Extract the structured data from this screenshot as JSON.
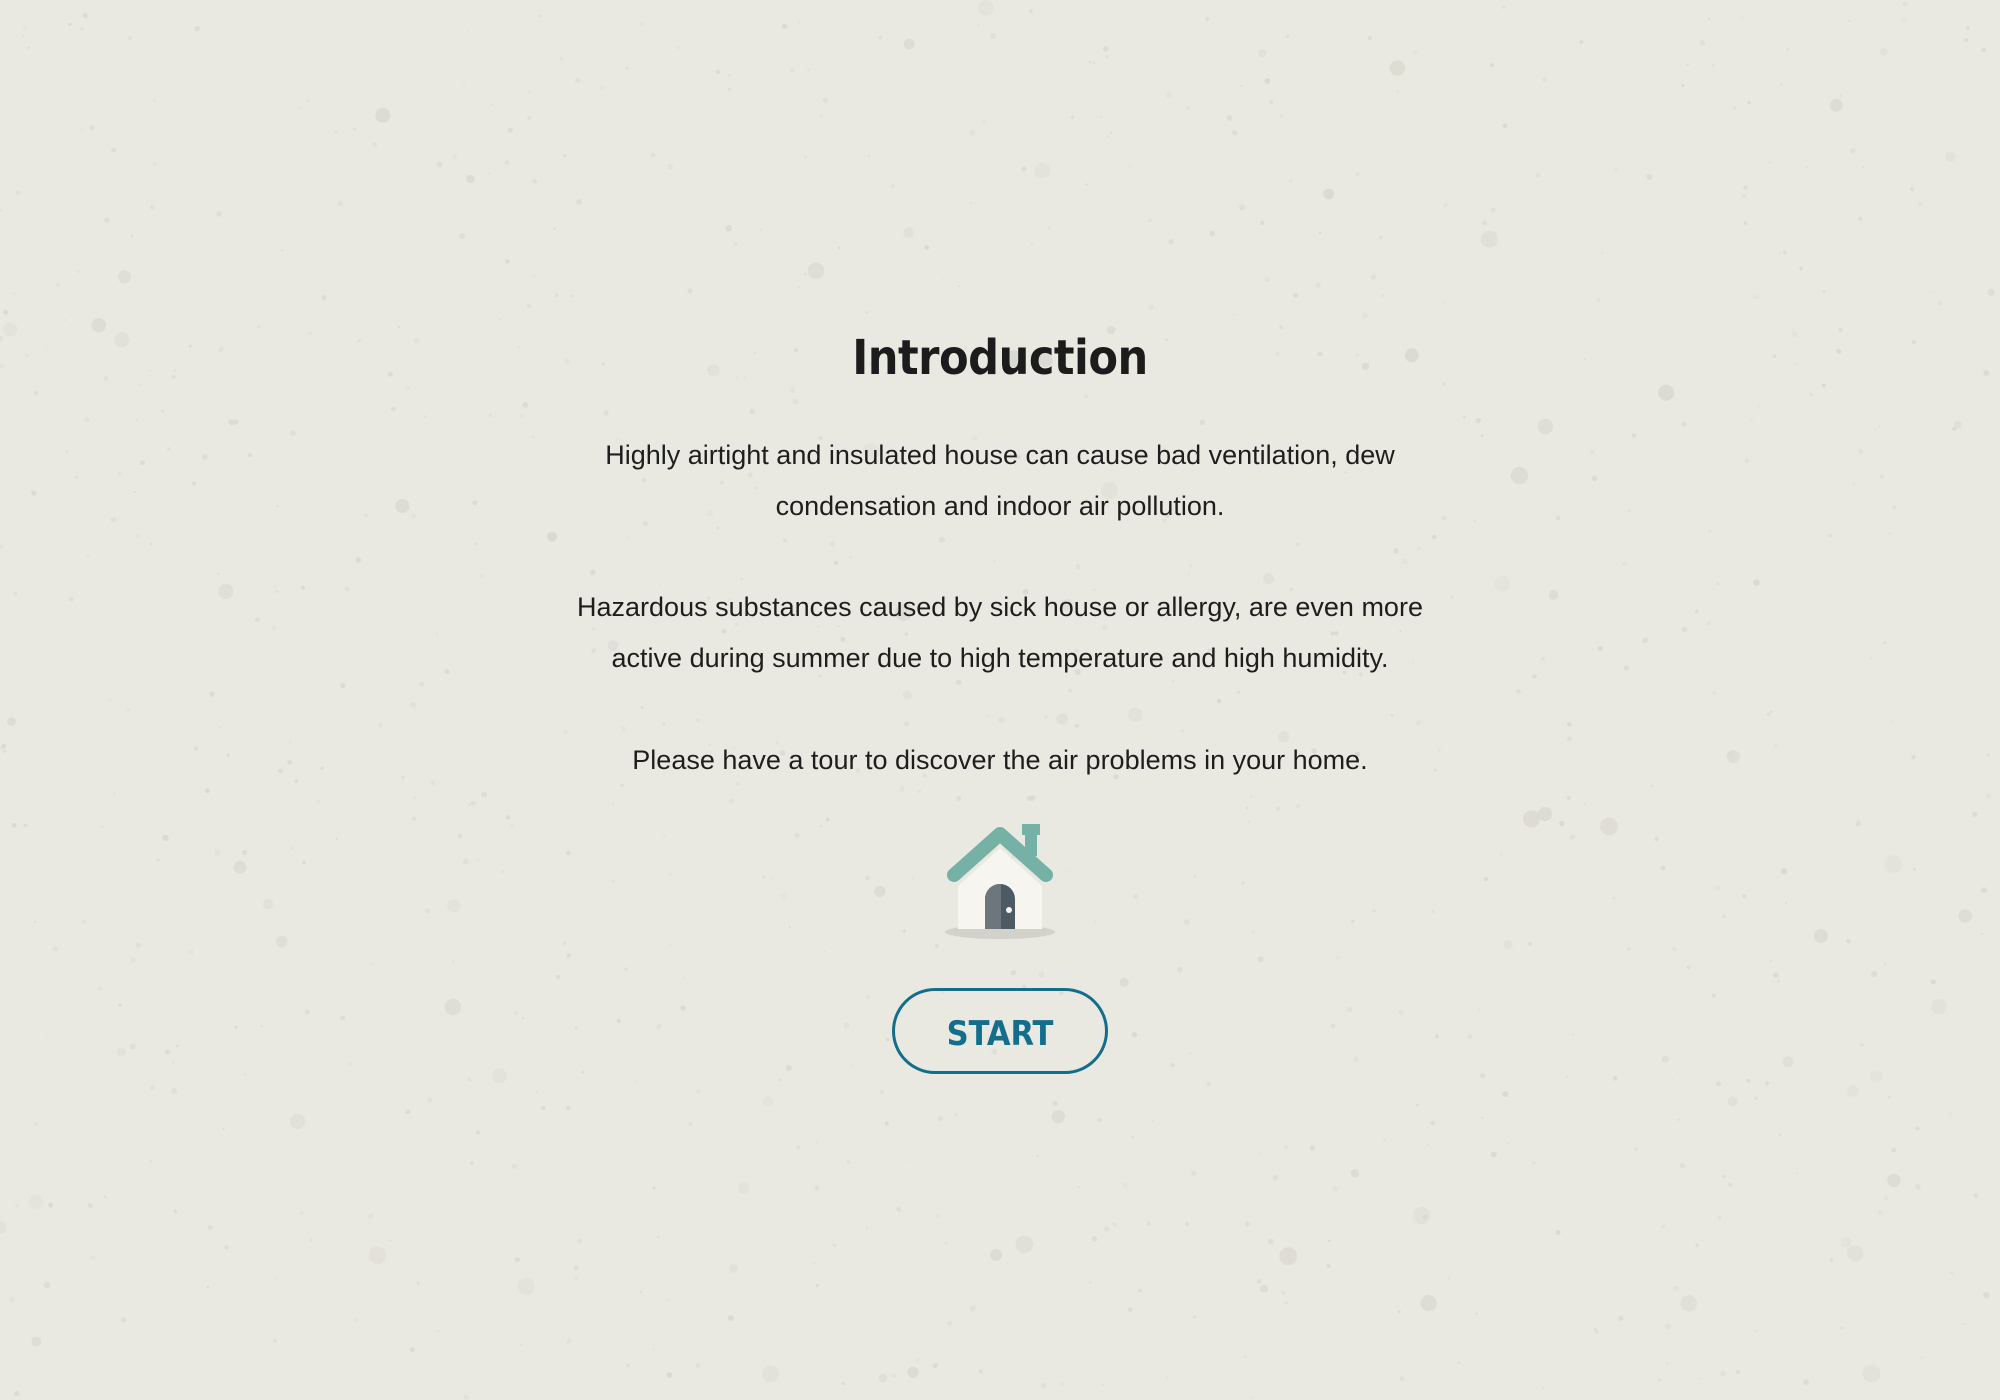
{
  "page": {
    "title": "Introduction",
    "paragraphs": [
      "Highly airtight and insulated house can cause bad ventilation, dew condensation and indoor air pollution.",
      "Hazardous substances caused by sick house or allergy, are even more active during summer due to high temperature and high humidity.",
      "Please have a tour to discover the air problems in your home."
    ],
    "icon": "house-icon",
    "start_label": "START"
  },
  "colors": {
    "background": "#e9e8e1",
    "text": "#1e1e1e",
    "accent": "#136e8c",
    "roof": "#76b1a5"
  }
}
